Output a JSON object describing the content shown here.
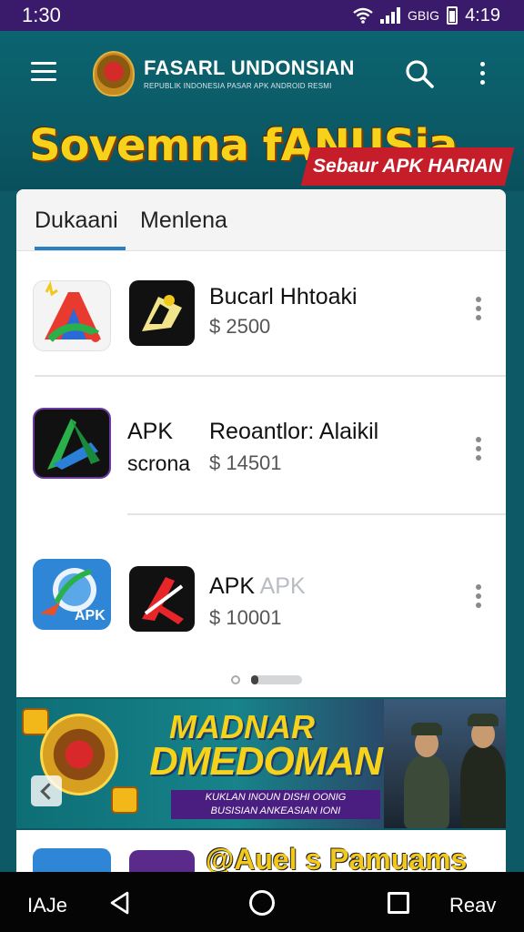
{
  "status_bar": {
    "time": "1:30",
    "carrier": "GBIG",
    "clock": "4:19"
  },
  "header": {
    "brand_title": "FASARL UNDONSIAN",
    "brand_subtitle": "REPUBLIK INDONESIA PASAR APK ANDROID RESMI",
    "hero_title": "Sovemna fANUSia.",
    "hero_ribbon": "Sebaur APK HARIAN"
  },
  "tabs": [
    {
      "label": "Dukaani"
    },
    {
      "label": "Menlena"
    }
  ],
  "apps": [
    {
      "name": "Bucarl Hhtoaki",
      "price": "$ 2500",
      "side_label": ""
    },
    {
      "name": "Reoantlor: Alaikil",
      "price": "$ 14501",
      "side_label_top": "APK",
      "side_label_bottom": "scrona"
    },
    {
      "name_main": "APK",
      "name_faded": "APK",
      "price": "$ 10001",
      "icon_text": "APK"
    }
  ],
  "banner": {
    "title_line1": "MADNAR",
    "title_line2": "DMEDOMAN",
    "subtitle_line1": "KUKLAN INOUN DISHI OONIG",
    "subtitle_line2": "BUSISIAN ANKEASIAN IONI"
  },
  "peek": {
    "title": "@Auel s Pamuams"
  },
  "nav_bar": {
    "left_label": "IAJe",
    "right_label": "Reav"
  },
  "colors": {
    "status_bar": "#3a1a6a",
    "header_bg": "#0b6470",
    "accent_yellow": "#f7d21a",
    "ribbon_red": "#c51d2a",
    "tab_indicator": "#2a7fc0"
  },
  "icons": [
    "menu-icon",
    "search-icon",
    "more-vert-icon",
    "back-icon",
    "home-icon",
    "recent-apps-icon",
    "wifi-icon",
    "signal-icon",
    "battery-icon"
  ]
}
